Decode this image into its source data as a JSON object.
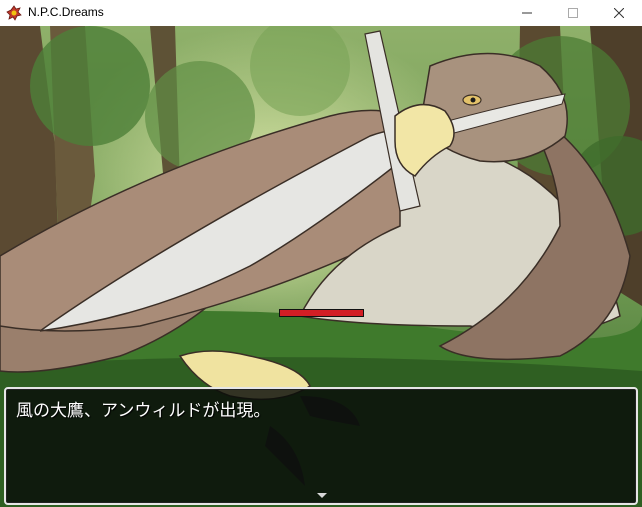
{
  "window": {
    "title": "N.P.C.Dreams",
    "icon": "app-logo-icon",
    "controls": [
      "minimize-icon",
      "maximize-icon",
      "close-icon"
    ]
  },
  "battle": {
    "enemy_name": "アンウィルド",
    "enemy_image": "giant-eagle",
    "background": "forest",
    "hp_fraction": 1.0,
    "colors": {
      "hp": "#d21e25",
      "window_bg": "#080c08",
      "window_border": "#e6e6e6"
    }
  },
  "message": {
    "text": "風の大鷹、アンウィルドが出現。",
    "advance_icon": "down-arrow-icon"
  }
}
